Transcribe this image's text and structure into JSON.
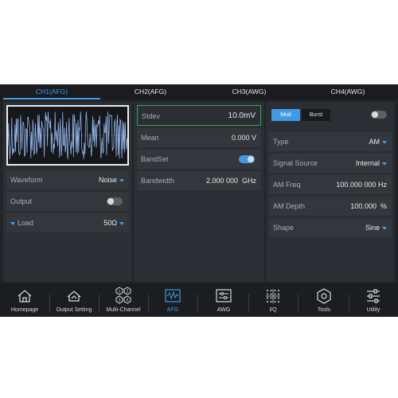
{
  "tabs": [
    {
      "label": "CH1(AFG)",
      "active": true
    },
    {
      "label": "CH2(AFG)",
      "active": false
    },
    {
      "label": "CH3(AWG)",
      "active": false
    },
    {
      "label": "CH4(AWG)",
      "active": false
    }
  ],
  "left": {
    "waveform_label": "Waveform",
    "waveform_value": "Noise",
    "output_label": "Output",
    "output_on": false,
    "load_label": "Load",
    "load_value": "50Ω"
  },
  "middle": {
    "stdev_label": "Stdev",
    "stdev_value": "10.0mV",
    "mean_label": "Mean",
    "mean_value": "0.000 V",
    "bandset_label": "BandSet",
    "bandset_on": true,
    "bandwidth_label": "Bandwidth",
    "bandwidth_value": "2.000 000",
    "bandwidth_unit": "GHz"
  },
  "right": {
    "mod_label": "Mod",
    "burst_label": "Burst",
    "mod_toggle_on": false,
    "type_label": "Type",
    "type_value": "AM",
    "source_label": "Signal Source",
    "source_value": "Internal",
    "freq_label": "AM Freq",
    "freq_value": "100.000 000",
    "freq_unit": "Hz",
    "depth_label": "AM Depth",
    "depth_value": "100.000",
    "depth_unit": "%",
    "shape_label": "Shape",
    "shape_value": "Sine"
  },
  "nav": [
    {
      "label": "Homepage",
      "icon": "home-icon"
    },
    {
      "label": "Output Setting",
      "icon": "output-setting-icon"
    },
    {
      "label": "Multi-Channel",
      "icon": "multi-channel-icon"
    },
    {
      "label": "AFG",
      "icon": "afg-wave-icon",
      "active": true
    },
    {
      "label": "AWG",
      "icon": "awg-icon"
    },
    {
      "label": "I/Q",
      "icon": "iq-constellation-icon"
    },
    {
      "label": "Tools",
      "icon": "tools-hexagon-icon"
    },
    {
      "label": "Utility",
      "icon": "utility-sliders-icon"
    }
  ],
  "colors": {
    "accent": "#3f9be6",
    "selected_border": "#2fa84f",
    "waveform": "#8fb2e6"
  }
}
